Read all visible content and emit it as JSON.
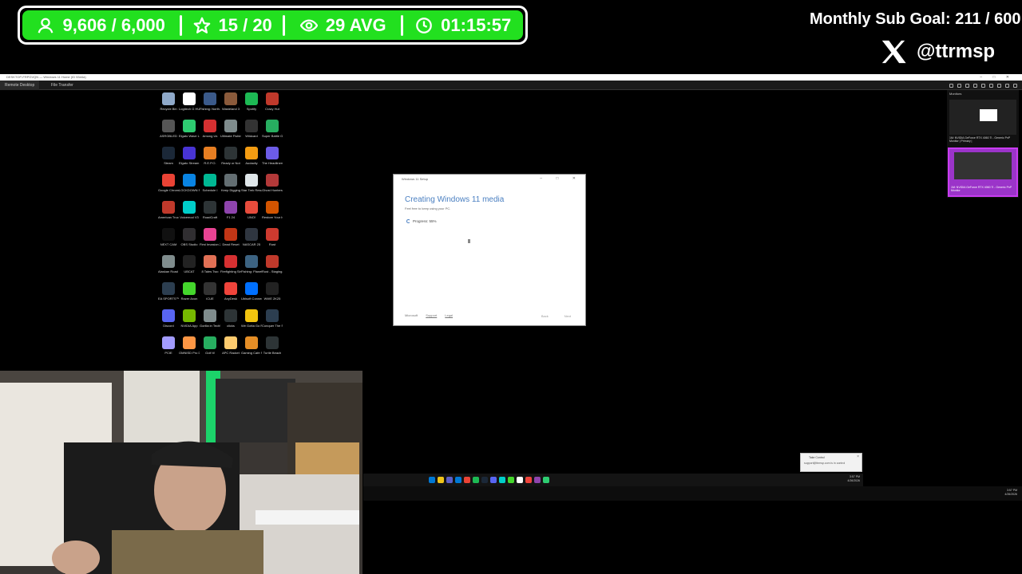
{
  "stats": {
    "followers": "9,606 / 6,000",
    "subs": "15 / 20",
    "viewers": "29 AVG",
    "uptime": "01:15:57"
  },
  "sub_goal": "Monthly Sub Goal:  211 / 600",
  "x_handle": "@ttrmsp",
  "remote": {
    "title": "DESKTOP-FRPGVQN — Windows 11 Home (ID 53d4a)",
    "tabs": [
      "Remote Desktop",
      "File Transfer"
    ],
    "controls": "– □ ✕"
  },
  "desktop_icons": [
    {
      "label": "Recycle Bin",
      "color": "#8fa9c9"
    },
    {
      "label": "Logitech G HUB",
      "color": "#ffffff"
    },
    {
      "label": "Fishing: North...",
      "color": "#3b5a8a"
    },
    {
      "label": "Wasteland 3",
      "color": "#8a5a3b"
    },
    {
      "label": "Spotify",
      "color": "#1db954"
    },
    {
      "label": "Crazy Hut",
      "color": "#c0392b"
    },
    {
      "label": "ASRGBLED",
      "color": "#555555"
    },
    {
      "label": "Elgato Wave Link",
      "color": "#2ecc71"
    },
    {
      "label": "Among Us",
      "color": "#d63031"
    },
    {
      "label": "Ultimate Fishing...",
      "color": "#7f8c8d"
    },
    {
      "label": "Wildcard",
      "color": "#333333"
    },
    {
      "label": "Super Battle Golf",
      "color": "#27ae60"
    },
    {
      "label": "Steam",
      "color": "#1b2838"
    },
    {
      "label": "Elgato Stream Deck",
      "color": "#4834d4"
    },
    {
      "label": "R.E.P.O.",
      "color": "#e67e22"
    },
    {
      "label": "Ready or Not",
      "color": "#2d3436"
    },
    {
      "label": "Audacity",
      "color": "#f39c12"
    },
    {
      "label": "The Headliners",
      "color": "#6c5ce7"
    },
    {
      "label": "Google Chrome",
      "color": "#ea4335"
    },
    {
      "label": "LOCKDOWN Protocol",
      "color": "#0984e3"
    },
    {
      "label": "Schedule I",
      "color": "#00b894"
    },
    {
      "label": "Keep Digging",
      "color": "#636e72"
    },
    {
      "label": "Star Trek Resurgence",
      "color": "#dfe6e9"
    },
    {
      "label": "Ghost Hunters",
      "color": "#b33939"
    },
    {
      "label": "American Truck Si...",
      "color": "#c0392b"
    },
    {
      "label": "Voicemod V3",
      "color": "#00cec9"
    },
    {
      "label": "RoadCraft",
      "color": "#2d3436"
    },
    {
      "label": "F1 24",
      "color": "#8e44ad"
    },
    {
      "label": "UNO!",
      "color": "#e74c3c"
    },
    {
      "label": "Restore Your Island Demo",
      "color": "#d35400"
    },
    {
      "label": "NEXT CAM",
      "color": "#111111"
    },
    {
      "label": "OBS Studio",
      "color": "#302e31"
    },
    {
      "label": "First Invasion 2",
      "color": "#e84393"
    },
    {
      "label": "Dead Reset",
      "color": "#c23616"
    },
    {
      "label": "NASCAR 25",
      "color": "#2f3640"
    },
    {
      "label": "Rust",
      "color": "#cd3a2f"
    },
    {
      "label": "Alaskan Road Truckers",
      "color": "#7f8c8d"
    },
    {
      "label": "UBCAT",
      "color": "#222222"
    },
    {
      "label": "8 Tales Two",
      "color": "#e17055"
    },
    {
      "label": "Firefighting Simulator...",
      "color": "#d63031"
    },
    {
      "label": "Fishing: Planet",
      "color": "#3c6382"
    },
    {
      "label": "Rust - Staging...",
      "color": "#c0392b"
    },
    {
      "label": "EA SPORTS™ WRC",
      "color": "#2c3e50"
    },
    {
      "label": "Razer Axon",
      "color": "#44d62c"
    },
    {
      "label": "iCUE",
      "color": "#333333"
    },
    {
      "label": "AnyDesk",
      "color": "#ef443b"
    },
    {
      "label": "Ubisoft Connect",
      "color": "#0070ff"
    },
    {
      "label": "WWE 2K25",
      "color": "#222222"
    },
    {
      "label": "Discord",
      "color": "#5865f2"
    },
    {
      "label": "NVIDIA App",
      "color": "#76b900"
    },
    {
      "label": "Gorilla in Tech!",
      "color": "#7f8c8d"
    },
    {
      "label": "clicks",
      "color": "#2d3436"
    },
    {
      "label": "We Gotta Go Playtest",
      "color": "#f1c40f"
    },
    {
      "label": "Conquer The Ship Sim",
      "color": "#2c3e50"
    },
    {
      "label": "PCIE",
      "color": "#a29bfe"
    },
    {
      "label": "OMNISD Pro Desktop",
      "color": "#fd9644"
    },
    {
      "label": "Golf It!",
      "color": "#27ae60"
    },
    {
      "label": "APC Racket",
      "color": "#fdcb6e"
    },
    {
      "label": "Gaming Cafe Simulator",
      "color": "#e58e26"
    },
    {
      "label": "Turtle Beach",
      "color": "#2d3436"
    }
  ],
  "setup": {
    "window_title": "Windows 11 Setup",
    "controls": "– □ ✕",
    "heading": "Creating Windows 11 media",
    "subtitle": "Feel free to keep using your PC.",
    "progress_text": "Progress: 55%",
    "progress": 0.55,
    "footer_links": [
      "Microsoft",
      "Support",
      "Legal"
    ],
    "back_label": "Back",
    "next_label": "Next"
  },
  "monitors": {
    "title": "Monitors",
    "monitor1_label": "1M: NVIDIA GeForce RTX 4060 Ti - Generic PnP Monitor | Primary |",
    "monitor2_label": "1M: NVIDIA GeForce RTX 4060 Ti - Generic PnP Monitor"
  },
  "remote_taskbar": {
    "time": "3:57 PM",
    "date": "4/26/2026",
    "icon_colors": [
      "#0078d4",
      "#f0c419",
      "#5b5fc7",
      "#0078d4",
      "#ea4335",
      "#1db954",
      "#1b2838",
      "#5865f2",
      "#00cec9",
      "#44d62c",
      "#ffffff",
      "#ef443b",
      "#8e44ad",
      "#2ecc71"
    ]
  },
  "toast": {
    "title": "Take Control",
    "body": "support@ttrmsp.com is in control"
  },
  "local_taskbar": {
    "time": "3:57 PM",
    "date": "4/26/2026"
  }
}
